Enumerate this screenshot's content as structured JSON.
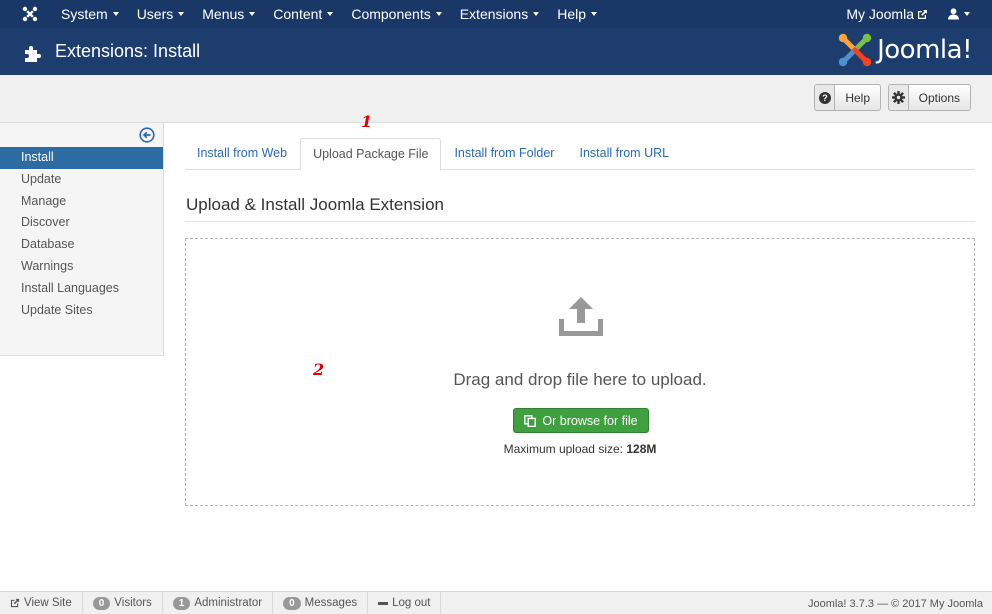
{
  "topnav": {
    "menu": [
      {
        "label": "System"
      },
      {
        "label": "Users"
      },
      {
        "label": "Menus"
      },
      {
        "label": "Content"
      },
      {
        "label": "Components"
      },
      {
        "label": "Extensions"
      },
      {
        "label": "Help"
      }
    ],
    "site_link": "My Joomla"
  },
  "header": {
    "title": "Extensions: Install",
    "brand": "Joomla!"
  },
  "toolbar": {
    "help_label": "Help",
    "options_label": "Options"
  },
  "annotations": {
    "one": "1",
    "two": "2"
  },
  "sidebar": {
    "items": [
      {
        "label": "Install",
        "active": true
      },
      {
        "label": "Update"
      },
      {
        "label": "Manage"
      },
      {
        "label": "Discover"
      },
      {
        "label": "Database"
      },
      {
        "label": "Warnings"
      },
      {
        "label": "Install Languages"
      },
      {
        "label": "Update Sites"
      }
    ]
  },
  "tabs": [
    {
      "label": "Install from Web"
    },
    {
      "label": "Upload Package File",
      "active": true
    },
    {
      "label": "Install from Folder"
    },
    {
      "label": "Install from URL"
    }
  ],
  "main": {
    "section_title": "Upload & Install Joomla Extension",
    "drag_text": "Drag and drop file here to upload.",
    "browse_label": "Or browse for file",
    "max_label": "Maximum upload size:",
    "max_value": "128M"
  },
  "statusbar": {
    "view_site": "View Site",
    "visitors_count": "0",
    "visitors_label": "Visitors",
    "admin_count": "1",
    "admin_label": "Administrator",
    "messages_count": "0",
    "messages_label": "Messages",
    "logout": "Log out",
    "version": "Joomla! 3.7.3",
    "copyright": "— © 2017 My Joomla"
  },
  "colors": {
    "nav_bg": "#1a3867",
    "header_bg": "#1c3d6e",
    "active_blue": "#2d6ca2",
    "link_blue": "#2a69b8",
    "success_green": "#3fa03f",
    "annotation_red": "#e00000"
  },
  "icons": {
    "brand": "joomla-logo-icon",
    "page": "puzzle-icon",
    "help": "question-circle-icon",
    "options": "gear-icon",
    "sidebar_toggle": "arrow-left-circle-icon",
    "upload": "upload-icon",
    "browse": "copy-icon",
    "external": "external-link-icon",
    "user": "user-icon"
  }
}
